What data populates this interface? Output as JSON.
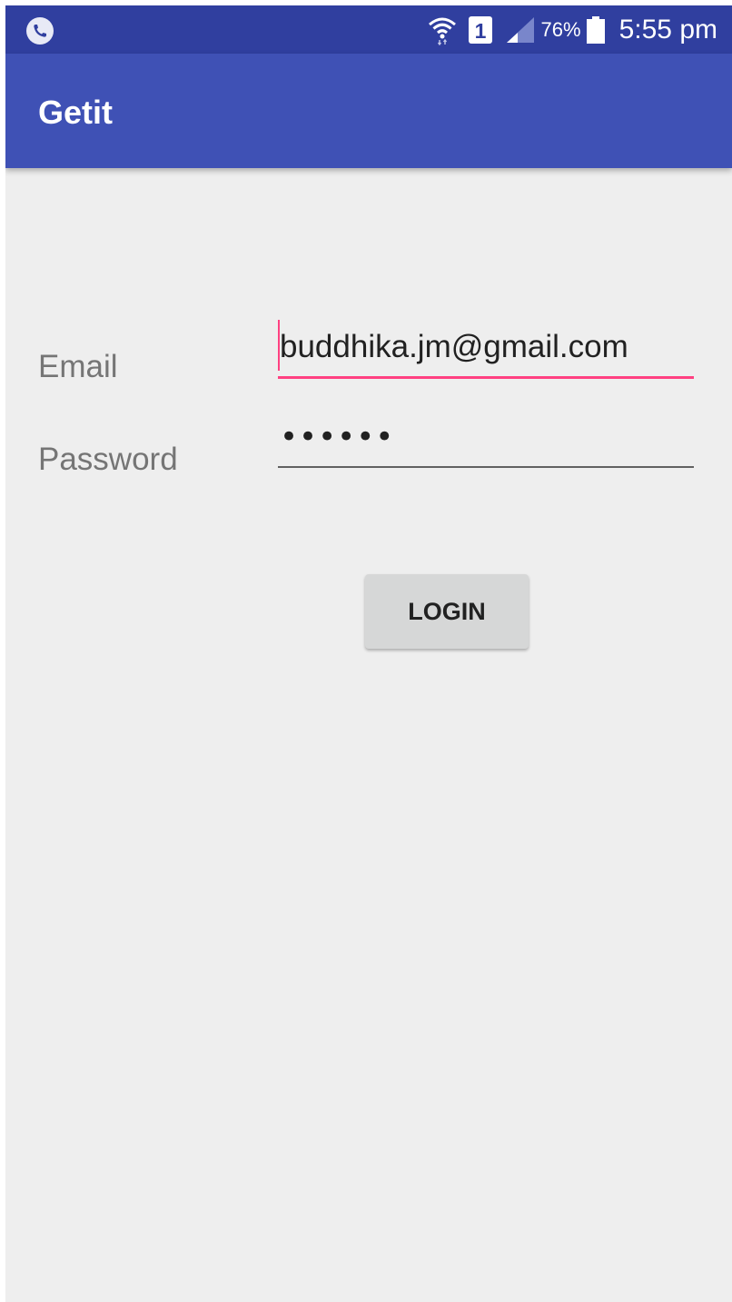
{
  "status_bar": {
    "left_icon": "phone-call-icon",
    "wifi_icon": "wifi-icon",
    "sim_label": "1",
    "signal_icon": "signal-icon",
    "battery_percent": "76%",
    "battery_icon": "battery-icon",
    "time": "5:55 pm"
  },
  "app_bar": {
    "title": "Getit",
    "color": "#3f51b5",
    "status_color": "#303f9f"
  },
  "form": {
    "email_label": "Email",
    "email_value": "buddhika.jm@gmail.com",
    "password_label": "Password",
    "password_value": "••••••",
    "accent_color": "#ff4081"
  },
  "login_button": {
    "label": "LOGIN"
  }
}
